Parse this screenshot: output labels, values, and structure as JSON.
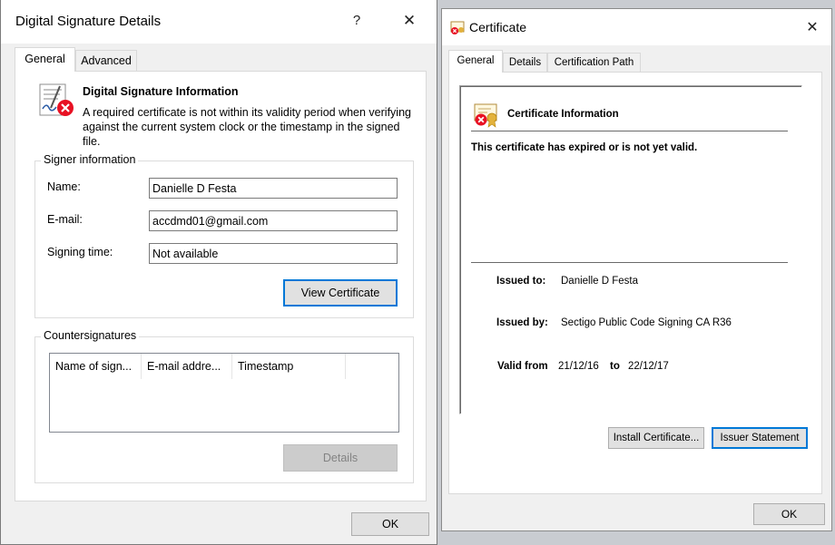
{
  "sig_dialog": {
    "title": "Digital Signature Details",
    "help_button": "?",
    "close_button": "✕",
    "tabs": [
      {
        "label": "General"
      },
      {
        "label": "Advanced"
      }
    ],
    "info": {
      "heading": "Digital Signature Information",
      "message": "A required certificate is not within its validity period when verifying against the current system clock or the timestamp in the signed file."
    },
    "signer": {
      "group_title": "Signer information",
      "name_label": "Name:",
      "name_value": "Danielle D Festa",
      "email_label": "E-mail:",
      "email_value": "accdmd01@gmail.com",
      "time_label": "Signing time:",
      "time_value": "Not available",
      "view_cert_button": "View Certificate"
    },
    "countersignatures": {
      "group_title": "Countersignatures",
      "columns": [
        "Name of sign...",
        "E-mail addre...",
        "Timestamp"
      ],
      "details_button": "Details"
    },
    "ok_button": "OK"
  },
  "cert_dialog": {
    "title": "Certificate",
    "close_button": "✕",
    "tabs": [
      {
        "label": "General"
      },
      {
        "label": "Details"
      },
      {
        "label": "Certification Path"
      }
    ],
    "info_heading": "Certificate Information",
    "status_message": "This certificate has expired or is not yet valid.",
    "issued_to_label": "Issued to:",
    "issued_to_value": "Danielle D Festa",
    "issued_by_label": "Issued by:",
    "issued_by_value": "Sectigo Public Code Signing CA R36",
    "valid_from_label": "Valid from",
    "valid_from_value": "21/12/16",
    "valid_to_label": "to",
    "valid_to_value": "22/12/17",
    "install_button": "Install Certificate...",
    "issuer_button": "Issuer Statement",
    "ok_button": "OK"
  },
  "colors": {
    "accent_blue": "#0078d7",
    "error_red": "#e81123"
  }
}
